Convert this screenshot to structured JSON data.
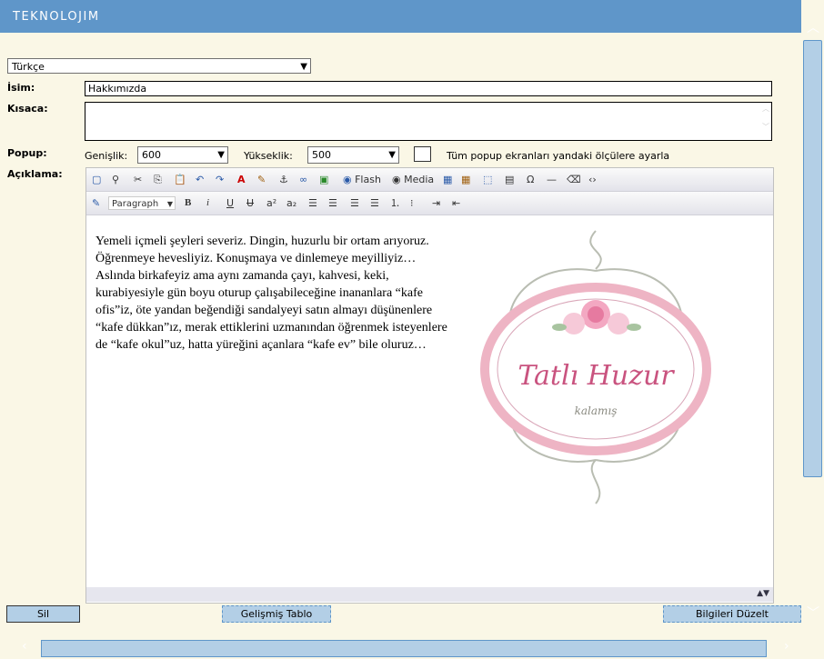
{
  "header": {
    "logo": "TEKNOLOJIM"
  },
  "form": {
    "language": {
      "selected": "Türkçe"
    },
    "isim": {
      "label": "İsim:",
      "value": "Hakkımızda"
    },
    "kisaca": {
      "label": "Kısaca:",
      "value": ""
    },
    "popup": {
      "label": "Popup:",
      "width_label": "Genişlik:",
      "width_value": "600",
      "height_label": "Yükseklik:",
      "height_value": "500",
      "apply_all_label": "Tüm popup ekranları yandaki ölçülere ayarla"
    },
    "aciklama": {
      "label": "Açıklama:"
    }
  },
  "editor": {
    "toolbar1": {
      "flash": "Flash",
      "media": "Media"
    },
    "toolbar2": {
      "format": "Paragraph",
      "bold": "B",
      "italic": "i",
      "underline": "U",
      "strike": "U",
      "sup": "a²",
      "sub": "a₂"
    },
    "text": "Yemeli içmeli şeyleri severiz. Dingin, huzurlu bir ortam arıyoruz. Öğrenmeye hevesliyiz. Konuşmaya ve dinlemeye meyilliyiz… Aslında birkafeyiz ama aynı zamanda çayı, kahvesi, keki, kurabiyesiyle gün boyu oturup çalışabileceğine inananlara “kafe ofis”iz, öte yandan beğendiği sandalyeyi satın almayı düşünenlere “kafe dükkan”ız, merak ettiklerini uzmanından öğrenmek isteyenlere de “kafe okul”uz, hatta yüreğini açanlara “kafe ev” bile oluruz…",
    "image": {
      "title": "Tatlı Huzur",
      "subtitle": "kalamış"
    }
  },
  "buttons": {
    "delete": "Sil",
    "advanced_table": "Gelişmiş Tablo",
    "update": "Bilgileri Düzelt"
  }
}
